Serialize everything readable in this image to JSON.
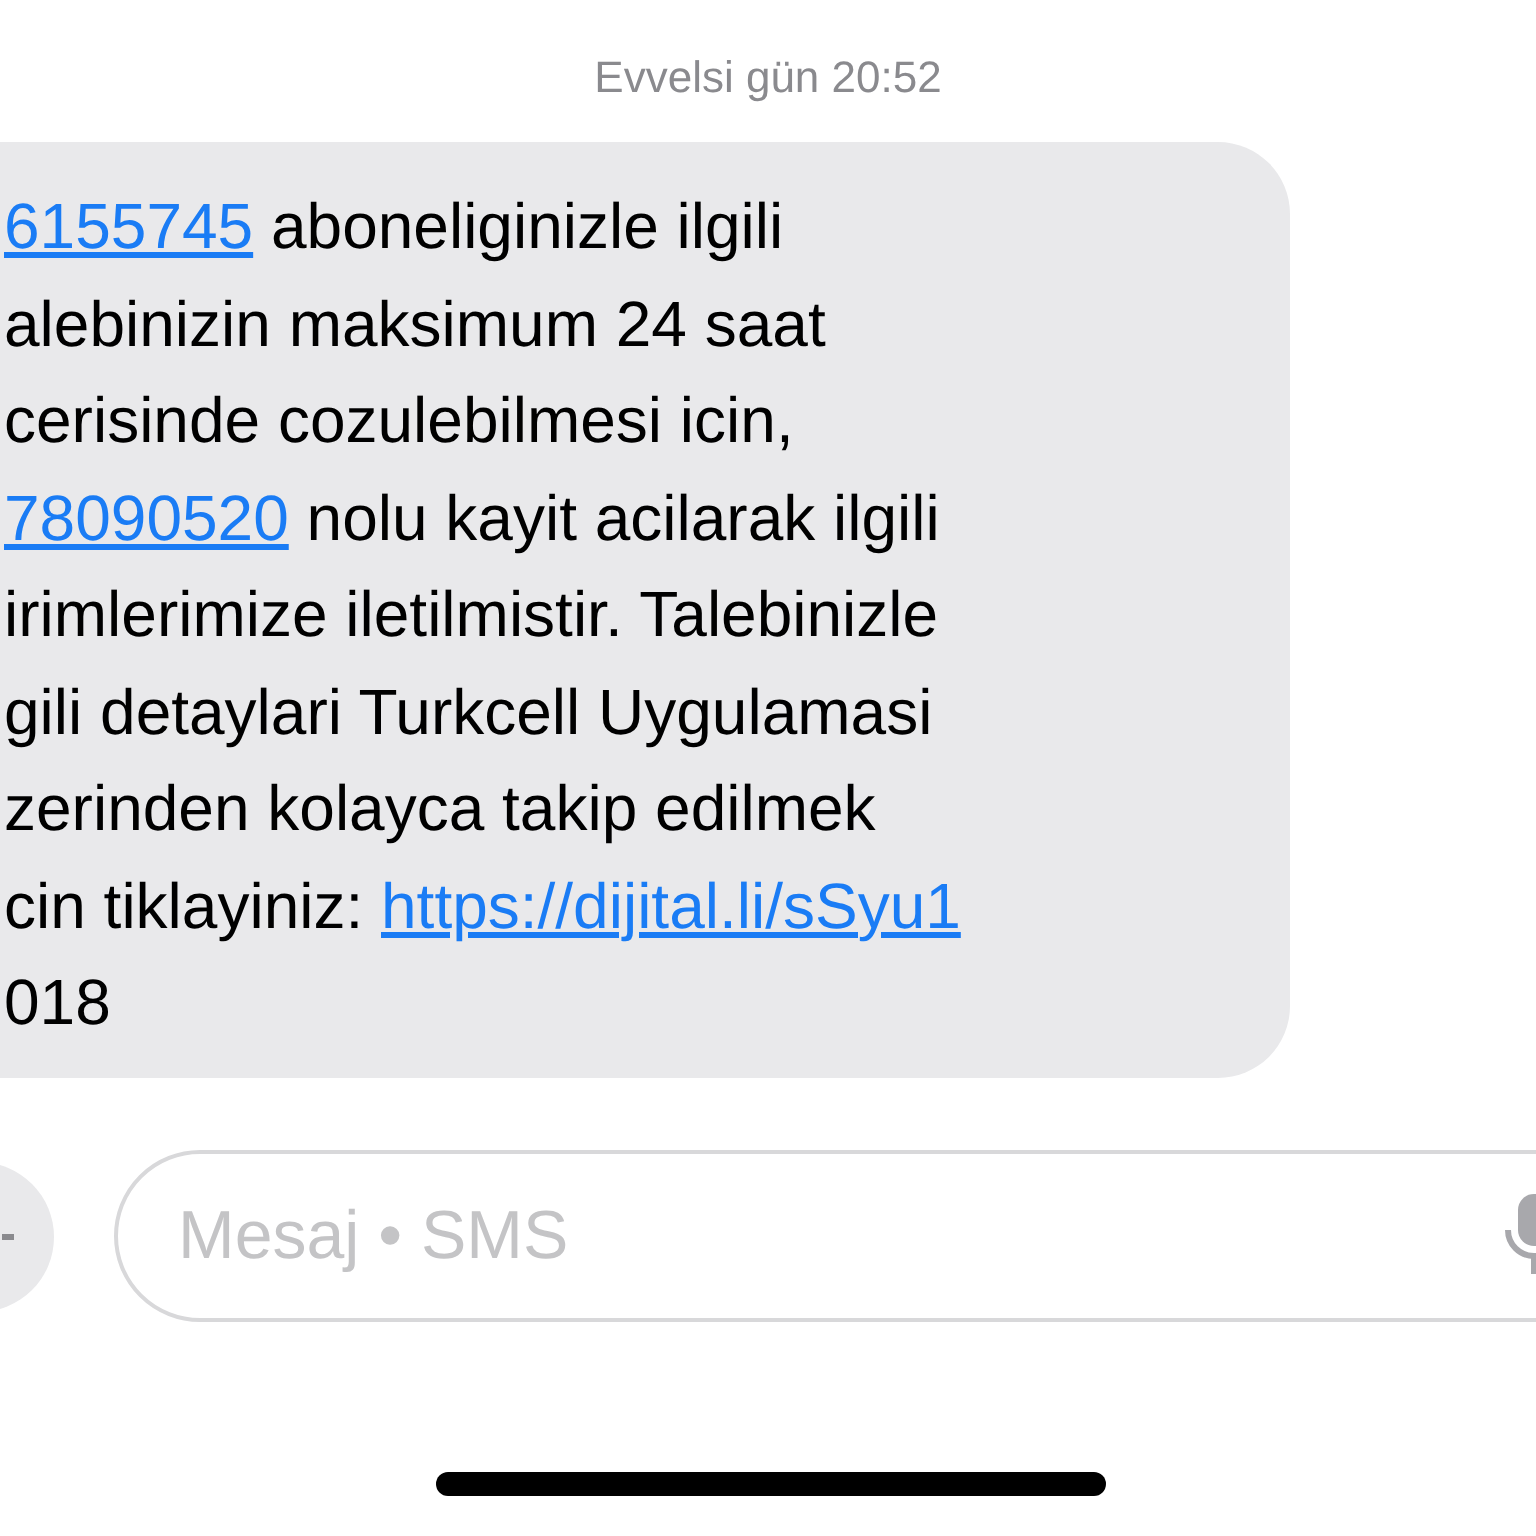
{
  "timestamp": "Evvelsi gün 20:52",
  "message": {
    "lines": [
      [
        {
          "kind": "link",
          "text": "6155745"
        },
        {
          "kind": "text",
          "text": " aboneliginizle ilgili"
        }
      ],
      [
        {
          "kind": "text",
          "text": "alebinizin maksimum 24 saat"
        }
      ],
      [
        {
          "kind": "text",
          "text": "cerisinde cozulebilmesi icin,"
        }
      ],
      [
        {
          "kind": "link",
          "text": "78090520"
        },
        {
          "kind": "text",
          "text": " nolu kayit acilarak ilgili"
        }
      ],
      [
        {
          "kind": "text",
          "text": "irimlerimize iletilmistir. Talebinizle"
        }
      ],
      [
        {
          "kind": "text",
          "text": "gili detaylari Turkcell Uygulamasi"
        }
      ],
      [
        {
          "kind": "text",
          "text": "zerinden kolayca takip edilmek"
        }
      ],
      [
        {
          "kind": "text",
          "text": "cin tiklayiniz: "
        },
        {
          "kind": "link",
          "text": "https://dijital.li/sSyu1"
        }
      ],
      [
        {
          "kind": "text",
          "text": "018"
        }
      ]
    ]
  },
  "composer": {
    "placeholder": "Mesaj • SMS"
  }
}
